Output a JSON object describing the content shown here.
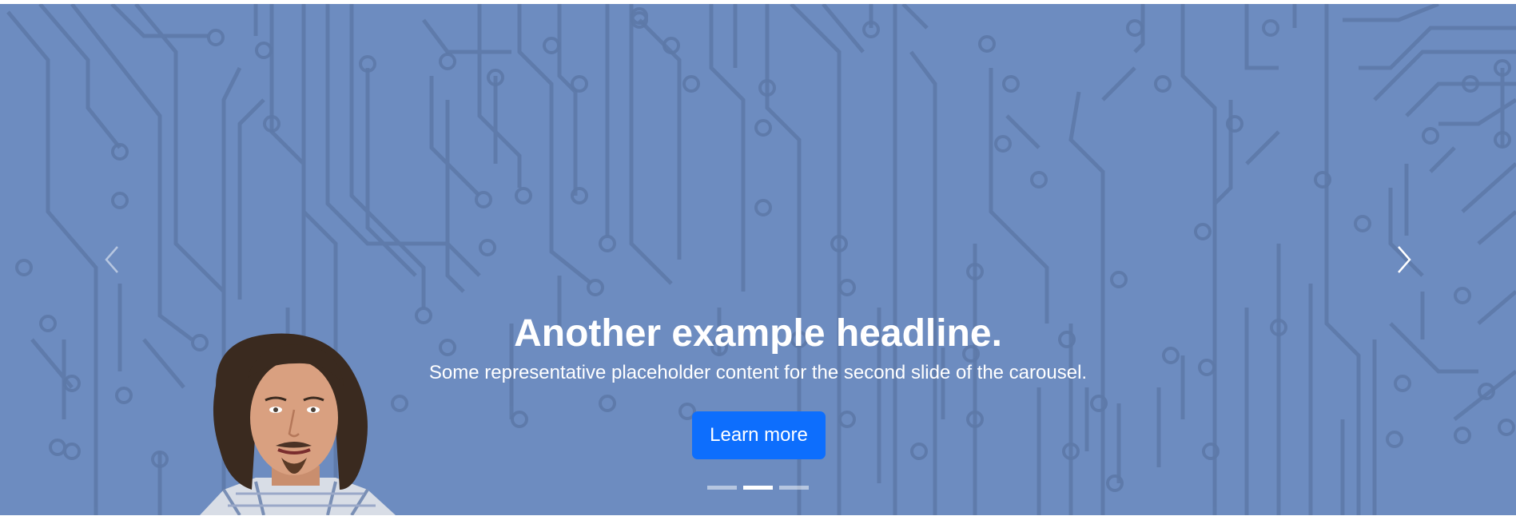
{
  "carousel": {
    "headline": "Another example headline.",
    "body": "Some representative placeholder content for the second slide of the carousel.",
    "button_label": "Learn more",
    "prev_icon": "chevron-left-icon",
    "next_icon": "chevron-right-icon",
    "indicators": [
      {
        "active": false
      },
      {
        "active": true
      },
      {
        "active": false
      }
    ],
    "colors": {
      "background": "#6d8cc0",
      "circuit_lines": "#5d79a8",
      "button": "#0d6efd",
      "text": "#ffffff"
    }
  }
}
